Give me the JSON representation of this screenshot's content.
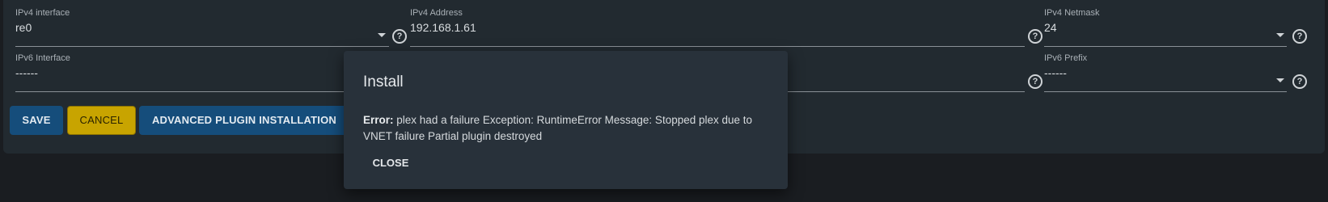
{
  "fields": {
    "ipv4_interface": {
      "label": "IPv4 interface",
      "value": "re0"
    },
    "ipv4_address": {
      "label": "IPv4 Address",
      "value": "192.168.1.61"
    },
    "ipv4_netmask": {
      "label": "IPv4 Netmask",
      "value": "24"
    },
    "ipv6_interface": {
      "label": "IPv6 Interface",
      "value": "------"
    },
    "ipv6_prefix": {
      "label": "IPv6 Prefix",
      "value": "------"
    }
  },
  "help_glyph": "?",
  "buttons": {
    "save": "SAVE",
    "cancel": "CANCEL",
    "advanced": "ADVANCED PLUGIN INSTALLATION"
  },
  "dialog": {
    "title": "Install",
    "error_label": "Error:",
    "error_text": "plex had a failure Exception: RuntimeError Message: Stopped plex due to VNET failure Partial plugin destroyed",
    "close_label": "CLOSE"
  },
  "colors": {
    "page_bg": "#1a1d21",
    "card_bg": "#222a30",
    "dialog_bg": "#28313a",
    "primary_button": "#154d7b",
    "cancel_button": "#c8a400"
  }
}
